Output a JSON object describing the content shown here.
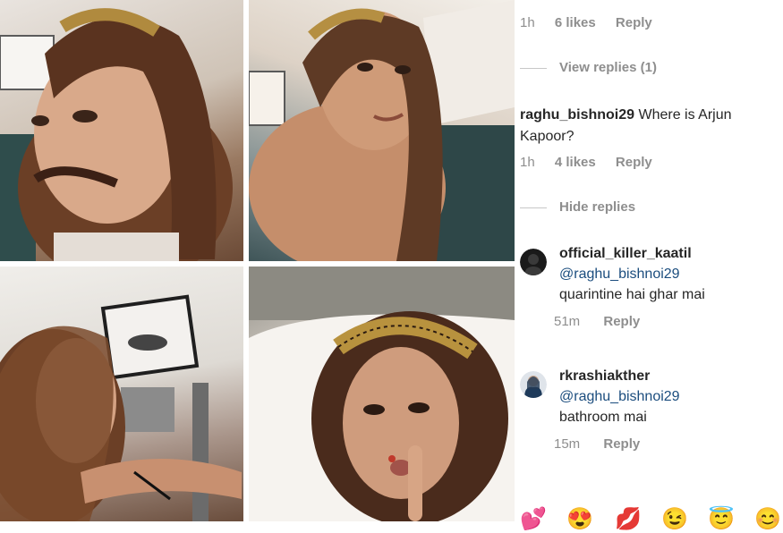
{
  "collage": {
    "photos": [
      {
        "name": "selfie-mustache"
      },
      {
        "name": "selfie-smile"
      },
      {
        "name": "selfie-arm"
      },
      {
        "name": "selfie-shush"
      }
    ]
  },
  "comments": {
    "top_meta": {
      "time": "1h",
      "likes": "6 likes",
      "reply": "Reply"
    },
    "view_replies": "View replies (1)",
    "main_comment": {
      "user": "raghu_bishnoi29",
      "text": "Where is Arjun Kapoor?",
      "time": "1h",
      "likes": "4 likes",
      "reply": "Reply"
    },
    "hide_replies": "Hide replies",
    "replies": [
      {
        "user": "official_killer_kaatil",
        "mention": "@raghu_bishnoi29",
        "text": "quarintine hai ghar mai",
        "time": "51m",
        "reply": "Reply"
      },
      {
        "user": "rkrashiakther",
        "mention": "@raghu_bishnoi29",
        "text": "bathroom mai",
        "time": "15m",
        "reply": "Reply"
      }
    ]
  },
  "emoji_bar": [
    "💕",
    "😍",
    "💋",
    "😉",
    "😇",
    "😊"
  ],
  "colors": {
    "mention": "#1b4d7e",
    "meta_gray": "#8e8e8e",
    "text": "#262626"
  }
}
